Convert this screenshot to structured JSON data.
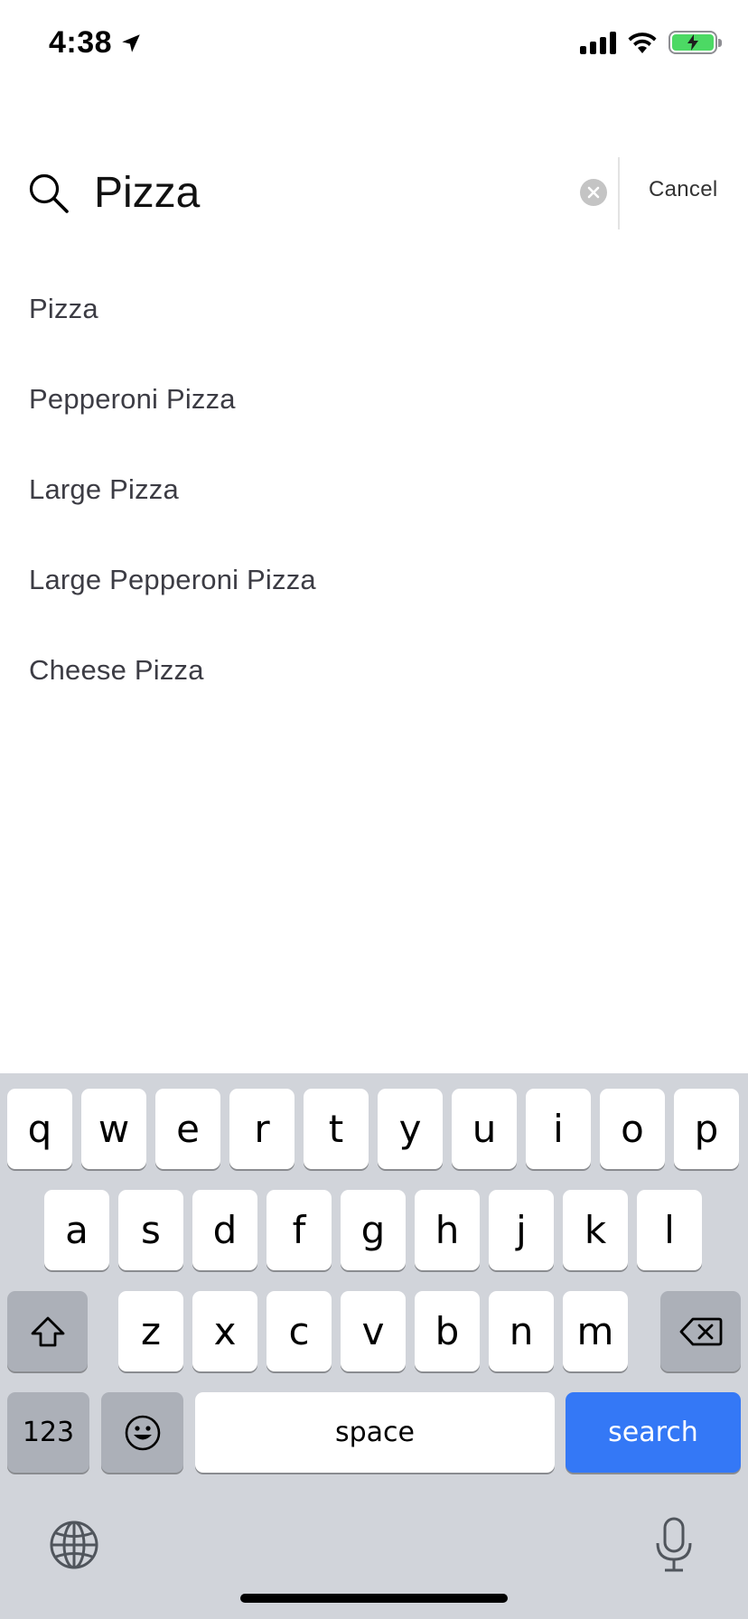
{
  "status_bar": {
    "time": "4:38",
    "icons": [
      "location-arrow-icon",
      "cellular-signal-icon",
      "wifi-icon",
      "battery-charging-icon"
    ]
  },
  "search": {
    "value": "Pizza",
    "cancel_label": "Cancel"
  },
  "suggestions": [
    "Pizza",
    "Pepperoni Pizza",
    "Large Pizza",
    "Large Pepperoni Pizza",
    "Cheese Pizza"
  ],
  "keyboard": {
    "row1": [
      "q",
      "w",
      "e",
      "r",
      "t",
      "y",
      "u",
      "i",
      "o",
      "p"
    ],
    "row2": [
      "a",
      "s",
      "d",
      "f",
      "g",
      "h",
      "j",
      "k",
      "l"
    ],
    "row3": [
      "z",
      "x",
      "c",
      "v",
      "b",
      "n",
      "m"
    ],
    "numbers_label": "123",
    "space_label": "space",
    "search_label": "search",
    "accent_color": "#3478f6"
  }
}
